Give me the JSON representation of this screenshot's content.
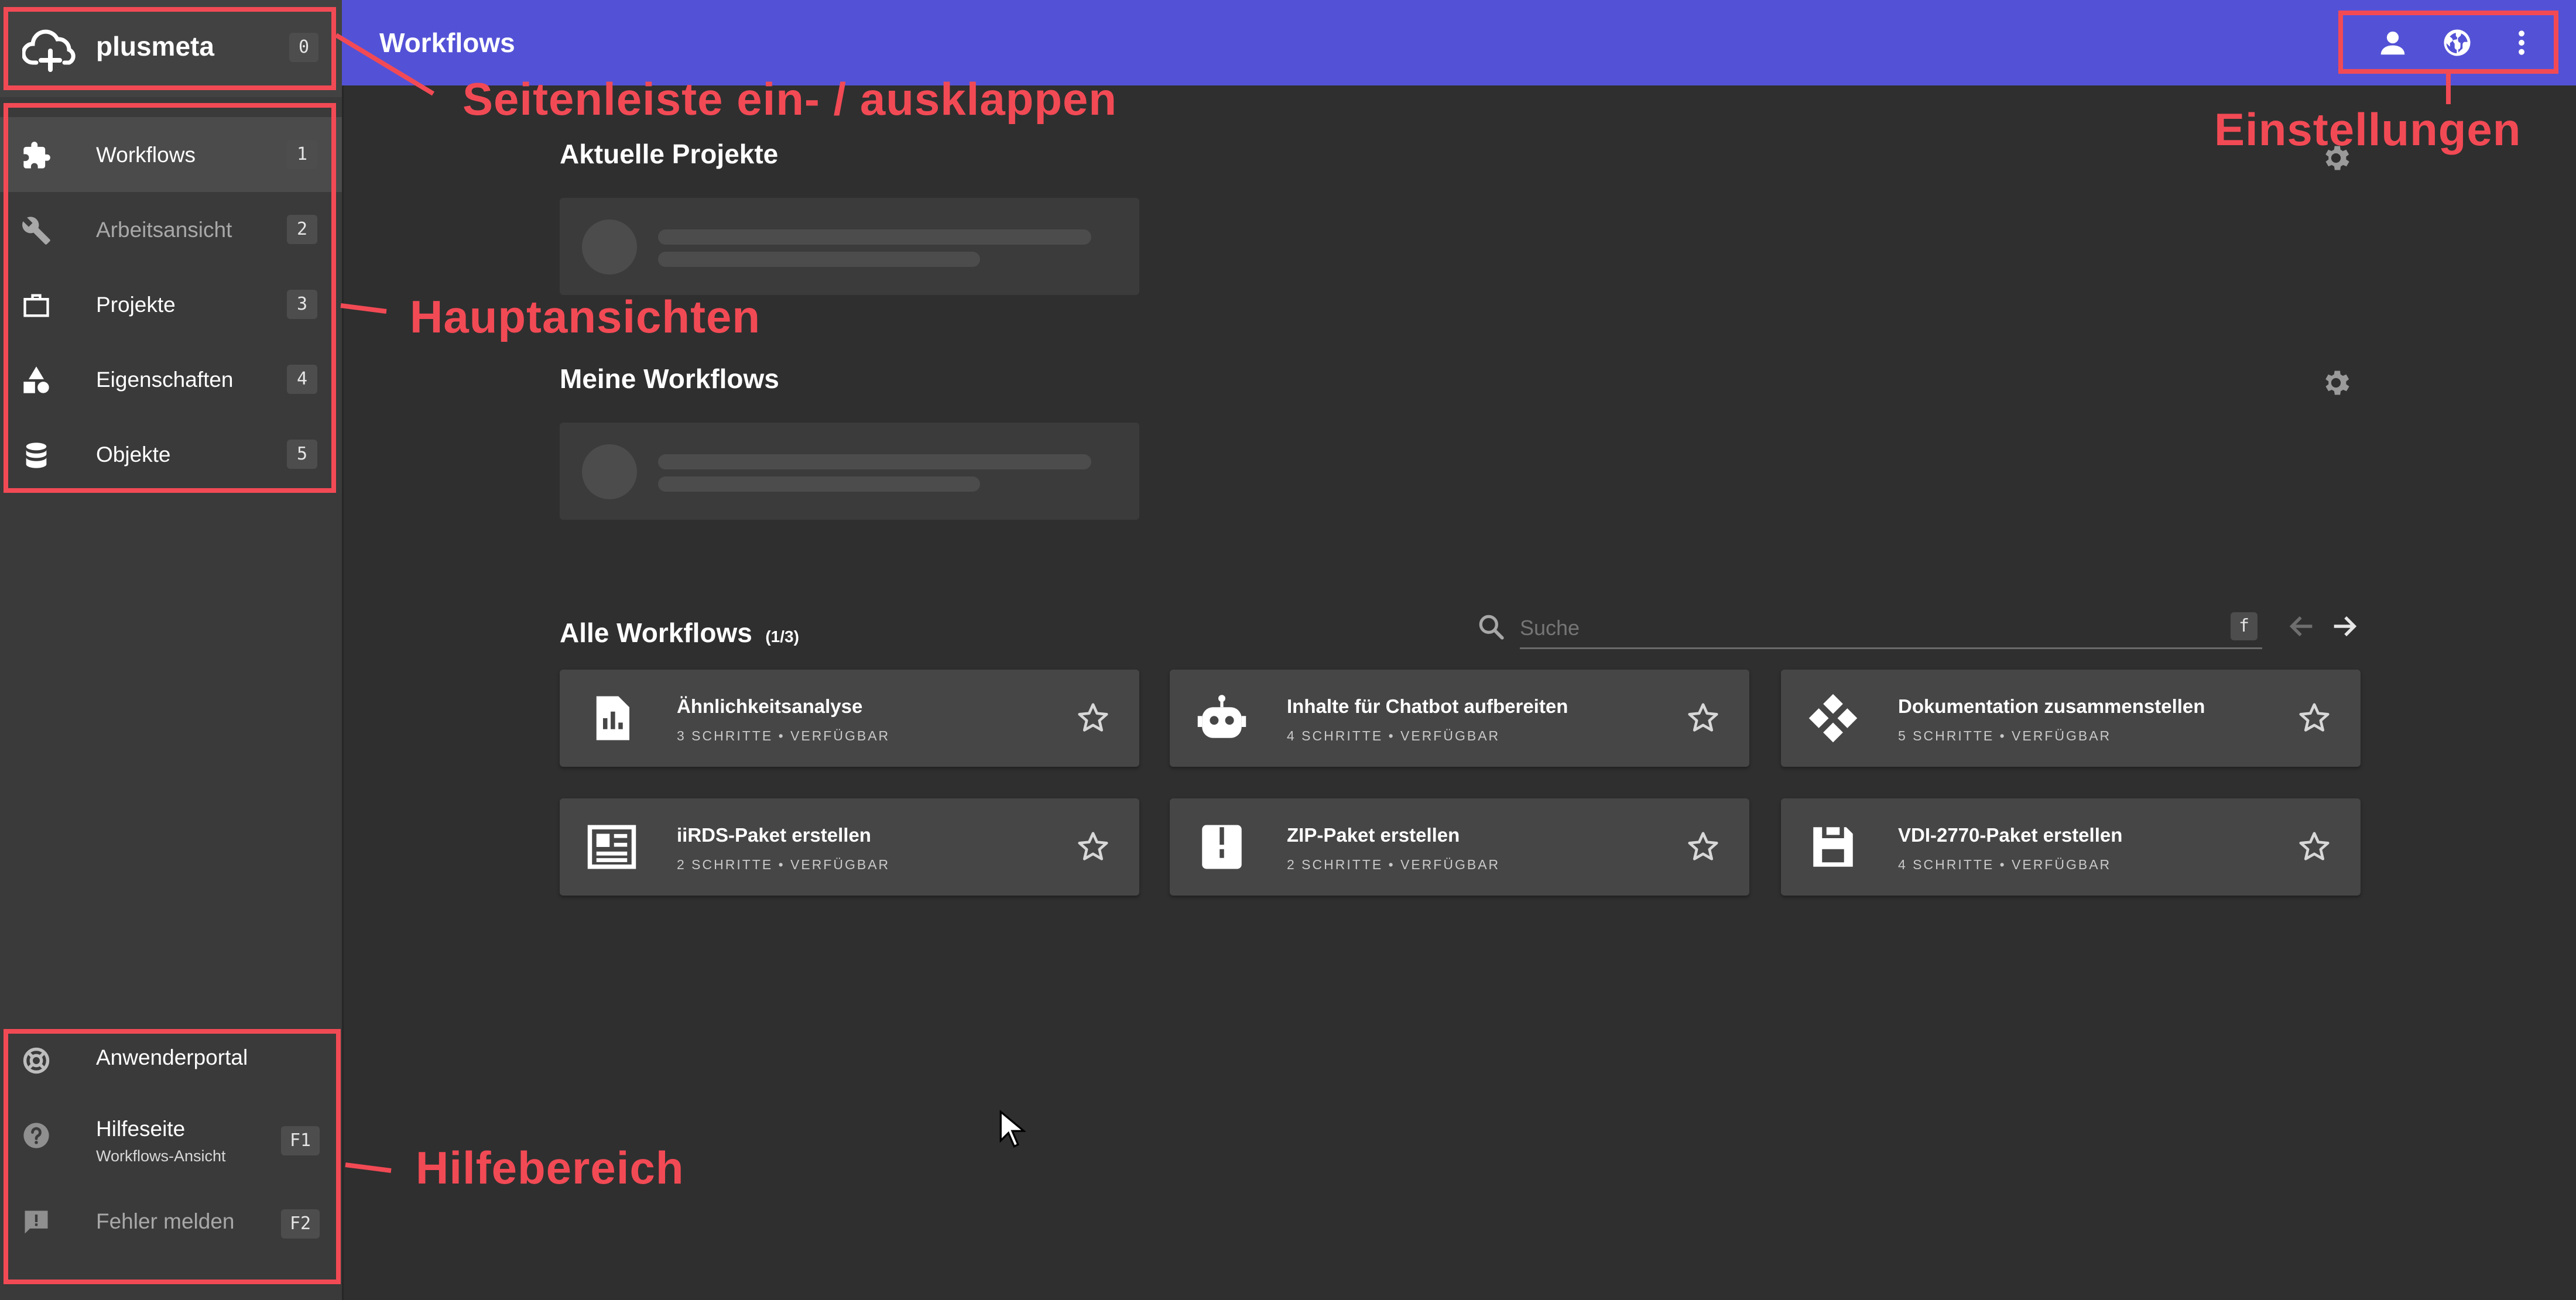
{
  "app": {
    "name": "plusmeta",
    "shortcut": "0"
  },
  "topbar": {
    "title": "Workflows",
    "icons": [
      "account-icon",
      "globe-icon",
      "more-vert-icon"
    ]
  },
  "sidebar": {
    "items": [
      {
        "label": "Workflows",
        "key": "1",
        "icon": "puzzle-icon",
        "active": true
      },
      {
        "label": "Arbeitsansicht",
        "key": "2",
        "icon": "wrench-icon",
        "active": false
      },
      {
        "label": "Projekte",
        "key": "3",
        "icon": "briefcase-icon",
        "active": false
      },
      {
        "label": "Eigenschaften",
        "key": "4",
        "icon": "shapes-icon",
        "active": false
      },
      {
        "label": "Objekte",
        "key": "5",
        "icon": "database-icon",
        "active": false
      }
    ],
    "help": [
      {
        "label": "Anwenderportal",
        "icon": "lifebuoy-icon"
      },
      {
        "label": "Hilfeseite",
        "sub": "Workflows-Ansicht",
        "key": "F1",
        "icon": "help-circle-icon"
      },
      {
        "label": "Fehler melden",
        "key": "F2",
        "icon": "feedback-icon"
      }
    ]
  },
  "main": {
    "recent_title": "Aktuelle Projekte",
    "my_title": "Meine Workflows",
    "all_title": "Alle Workflows",
    "all_page": "(1/3)",
    "search": {
      "placeholder": "Suche",
      "shortcut": "f"
    },
    "workflows": [
      {
        "name": "Ähnlichkeitsanalyse",
        "meta": "3 SCHRITTE • VERFÜGBAR",
        "icon": "chart-document-icon"
      },
      {
        "name": "Inhalte für Chatbot aufbereiten",
        "meta": "4 SCHRITTE • VERFÜGBAR",
        "icon": "robot-icon"
      },
      {
        "name": "Dokumentation zusammenstellen",
        "meta": "5 SCHRITTE • VERFÜGBAR",
        "icon": "diamonds-icon"
      },
      {
        "name": "iiRDS-Paket erstellen",
        "meta": "2 SCHRITTE • VERFÜGBAR",
        "icon": "newspaper-icon"
      },
      {
        "name": "ZIP-Paket erstellen",
        "meta": "2 SCHRITTE • VERFÜGBAR",
        "icon": "zip-icon"
      },
      {
        "name": "VDI-2770-Paket erstellen",
        "meta": "4 SCHRITTE • VERFÜGBAR",
        "icon": "floppy-icon"
      }
    ]
  },
  "annotations": {
    "sidebar_toggle": "Seitenleiste ein- / ausklappen",
    "main_views": "Hauptansichten",
    "settings": "Einstellungen",
    "help_area": "Hilfebereich",
    "color": "#f24a55"
  },
  "colors": {
    "topbar": "#5352d6",
    "background": "#2f2f2f",
    "sidebar": "#3a3a3a"
  }
}
